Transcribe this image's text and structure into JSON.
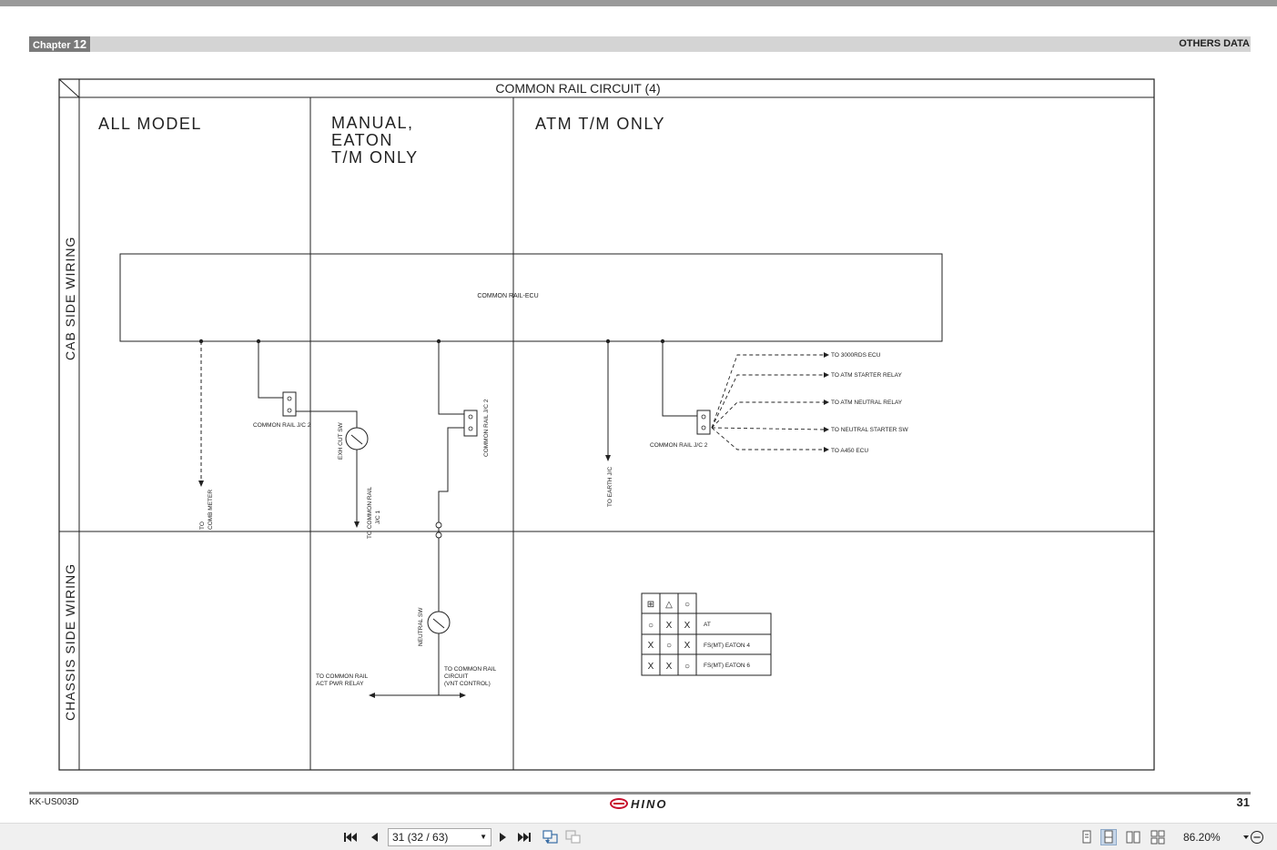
{
  "header": {
    "chapter_label": "Chapter",
    "chapter_number": "12",
    "section": "OTHERS DATA"
  },
  "diagram": {
    "title": "COMMON RAIL CIRCUIT (4)",
    "row_labels": {
      "cab": "CAB SIDE WIRING",
      "chassis": "CHASSIS SIDE WIRING"
    },
    "columns": {
      "all": "ALL MODEL",
      "manual_1": "MANUAL,",
      "manual_2": "EATON",
      "manual_3": "T/M ONLY",
      "atm": "ATM T/M ONLY"
    },
    "ecu": "COMMON RAIL-ECU",
    "labels": {
      "jc2_a": "COMMON RAIL J/C 2",
      "jc2_b": "COMMON RAIL J/C 2",
      "jc2_c": "COMMON RAIL J/C 2",
      "combmeter_1": "TO",
      "combmeter_2": "COMB METER",
      "exh": "EXH CUT SW",
      "to_jc1_1": "TO COMMON RAIL",
      "to_jc1_2": "J/C 1",
      "earth": "TO EARTH J/C",
      "neutral_sw": "NEUTRAL SW",
      "act_1": "TO COMMON RAIL",
      "act_2": "ACT PWR RELAY",
      "vnt_1": "TO COMMON RAIL",
      "vnt_2": "CIRCUIT",
      "vnt_3": "(VNT CONTROL)",
      "to_3000": "TO 3000RDS ECU",
      "to_atm_starter": "TO ATM STARTER RELAY",
      "to_atm_neutral": "TO ATM NEUTRAL RELAY",
      "to_neutral_starter": "TO NEUTRAL STARTER SW",
      "to_a450": "TO A450 ECU"
    },
    "legend": {
      "header": [
        "⊞",
        "△",
        "○"
      ],
      "rows": [
        {
          "cells": [
            "○",
            "X",
            "X"
          ],
          "name": "AT"
        },
        {
          "cells": [
            "X",
            "○",
            "X"
          ],
          "name": "FS(MT) EATON 4"
        },
        {
          "cells": [
            "X",
            "X",
            "○"
          ],
          "name": "FS(MT) EATON 6"
        }
      ]
    }
  },
  "footer": {
    "doc_code": "KK-US003D",
    "page_number": "31",
    "brand": "HINO"
  },
  "viewer": {
    "page_field": "31 (32 / 63)",
    "zoom": "86.20%"
  },
  "colors": {
    "brand_red": "#c8102e",
    "header_dark": "#7a7a7a",
    "header_band": "#d4d4d4"
  }
}
